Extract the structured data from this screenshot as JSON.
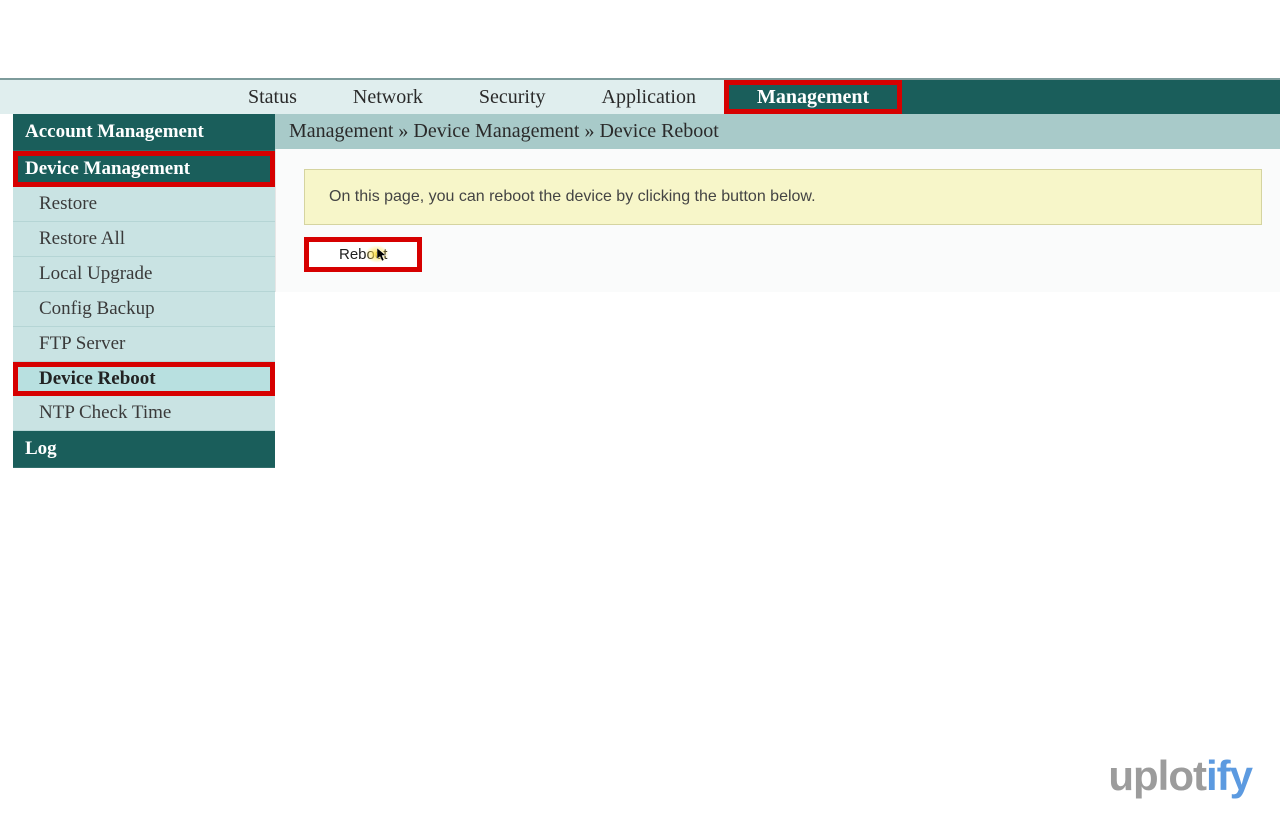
{
  "nav": {
    "items": [
      {
        "label": "Status"
      },
      {
        "label": "Network"
      },
      {
        "label": "Security"
      },
      {
        "label": "Application"
      },
      {
        "label": "Management",
        "active": true
      }
    ]
  },
  "sidebar": {
    "sections": [
      {
        "label": "Account Management",
        "type": "header"
      },
      {
        "label": "Device Management",
        "type": "subheader",
        "highlighted": true
      },
      {
        "label": "Restore",
        "type": "item"
      },
      {
        "label": "Restore All",
        "type": "item"
      },
      {
        "label": "Local Upgrade",
        "type": "item"
      },
      {
        "label": "Config Backup",
        "type": "item"
      },
      {
        "label": "FTP Server",
        "type": "item"
      },
      {
        "label": "Device Reboot",
        "type": "item",
        "selected": true,
        "highlighted": true
      },
      {
        "label": "NTP Check Time",
        "type": "item"
      },
      {
        "label": "Log",
        "type": "header"
      }
    ]
  },
  "breadcrumb": {
    "part1": "Management",
    "sep": " » ",
    "part2": "Device Management",
    "part3": "Device Reboot"
  },
  "content": {
    "info_text": "On this page, you can reboot the device by clicking the button below.",
    "reboot_label": "Reboot"
  },
  "watermark": {
    "part1": "uplot",
    "part2": "ify"
  }
}
